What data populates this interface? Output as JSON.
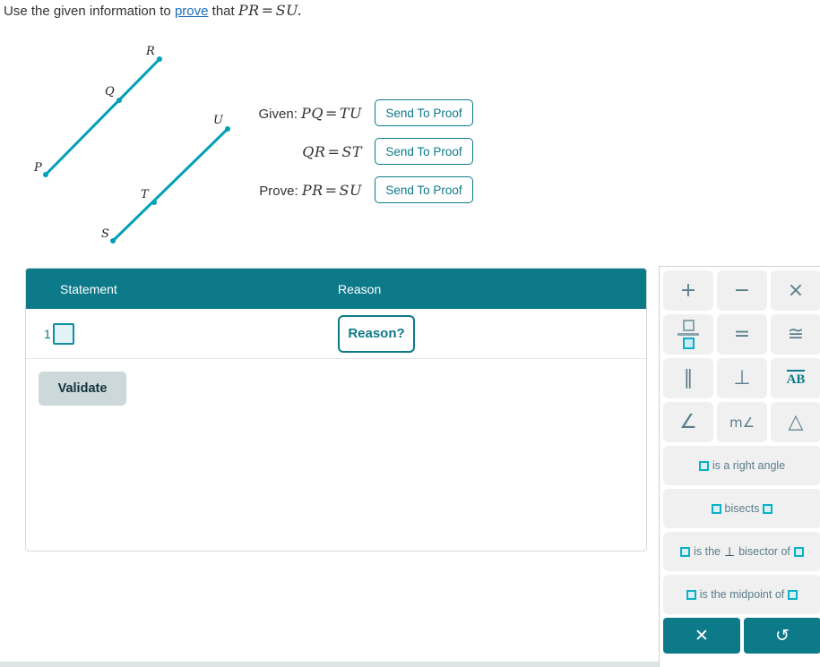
{
  "prompt": {
    "before_link": "Use the given information to",
    "link": "prove",
    "after_link": "that",
    "statement_left": "PR",
    "statement_eq": "=",
    "statement_right": "SU",
    "period": "."
  },
  "figure": {
    "labels": {
      "p": "P",
      "q": "Q",
      "r": "R",
      "s": "S",
      "t": "T",
      "u": "U"
    },
    "line_color": "#00a0b8"
  },
  "given": {
    "rows": [
      {
        "prefix": "Given:",
        "left": "PQ",
        "eq": "=",
        "right": "TU",
        "button": "Send To Proof"
      },
      {
        "prefix": "",
        "left": "QR",
        "eq": "=",
        "right": "ST",
        "button": "Send To Proof"
      },
      {
        "prefix": "Prove:",
        "left": "PR",
        "eq": "=",
        "right": "SU",
        "button": "Send To Proof"
      }
    ]
  },
  "proof_table": {
    "headers": {
      "statement": "Statement",
      "reason": "Reason"
    },
    "rows": [
      {
        "number": "1",
        "statement_value": "",
        "reason_button": "Reason?"
      }
    ],
    "validate_button": "Validate",
    "header_color": "#0d7a8a"
  },
  "keypad": {
    "keys": [
      {
        "name": "plus-key",
        "glyph": "+"
      },
      {
        "name": "minus-key",
        "glyph": "−"
      },
      {
        "name": "multiply-key",
        "glyph": "×"
      },
      {
        "name": "fraction-key",
        "glyph": ""
      },
      {
        "name": "equals-key",
        "glyph": "="
      },
      {
        "name": "congruent-key",
        "glyph": "≅"
      },
      {
        "name": "parallel-key",
        "glyph": "∥"
      },
      {
        "name": "perpendicular-key",
        "glyph": "⊥"
      },
      {
        "name": "segment-key",
        "glyph": "AB"
      },
      {
        "name": "angle-key",
        "glyph": "∠"
      },
      {
        "name": "measure-angle-key",
        "glyph": "m∠"
      },
      {
        "name": "triangle-key",
        "glyph": "△"
      }
    ],
    "phrases": [
      {
        "name": "right-angle-phrase",
        "parts": [
          "box",
          " is a right angle"
        ]
      },
      {
        "name": "bisects-phrase",
        "parts": [
          "box",
          " bisects ",
          "box"
        ]
      },
      {
        "name": "perp-bisector-phrase",
        "parts": [
          "box",
          " is the ",
          "perp",
          " bisector of ",
          "box"
        ]
      },
      {
        "name": "midpoint-phrase",
        "parts": [
          "box",
          " is the midpoint of ",
          "box"
        ]
      }
    ],
    "phrase_labels": {
      "right_angle": "is a right angle",
      "bisects": "bisects",
      "perp_bisector_a": "is the",
      "perp_bisector_b": "bisector of",
      "perp_symbol": "⊥",
      "midpoint": "is the midpoint of"
    },
    "actions": [
      {
        "name": "clear-button",
        "glyph": "✕"
      },
      {
        "name": "undo-button",
        "glyph": "↺"
      }
    ]
  }
}
